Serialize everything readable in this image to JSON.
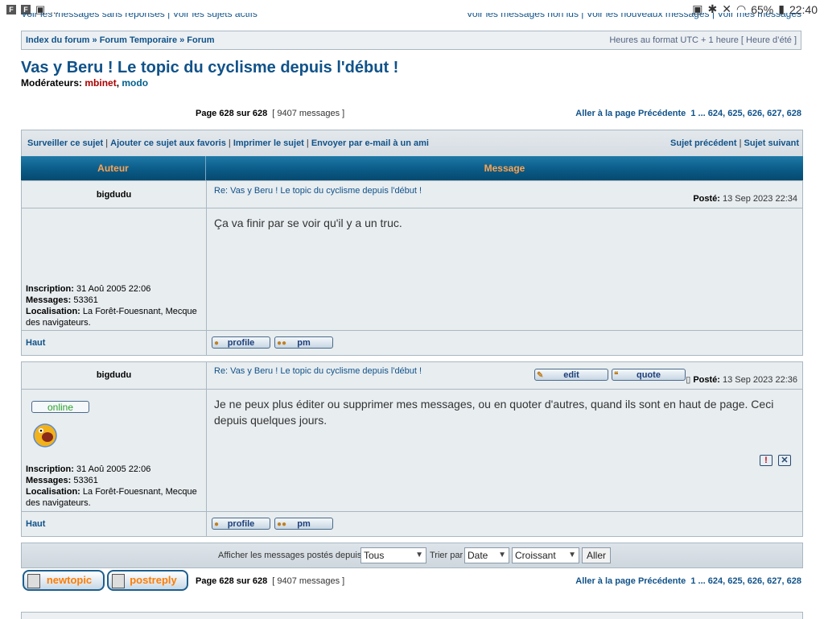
{
  "statusbar": {
    "icons": [
      "F",
      "F",
      "▣"
    ],
    "dots": "...",
    "battery": "65%",
    "time": "22:40"
  },
  "cut_links": {
    "left": "Voir les messages sans réponses | Voir les sujets actifs",
    "right": "Voir les messages non lus | Voir les nouveaux messages | Voir mes messages"
  },
  "breadcrumb": {
    "index": "Index du forum",
    "sep": " » ",
    "f1": "Forum Temporaire",
    "f2": "Forum",
    "timezone": "Heures au format UTC + 1 heure [ Heure d’été ]"
  },
  "topic": {
    "title": "Vas y Beru ! Le topic du cyclisme depuis l'début !",
    "mods_label": "Modérateurs:",
    "mod1": "mbinet",
    "mod2": "modo"
  },
  "pagination": {
    "page": "Page 628 sur 628",
    "count": "[ 9407 messages ]",
    "goto_label": "Aller à la page",
    "prev": "Précédente",
    "pages": "1 ... 624, 625, 626, 627, 628"
  },
  "tools": {
    "watch": "Surveiller ce sujet",
    "fav": "Ajouter ce sujet aux favoris",
    "print": "Imprimer le sujet",
    "email": "Envoyer par e-mail à un ami",
    "prev_topic": "Sujet précédent",
    "next_topic": "Sujet suivant"
  },
  "table_head": {
    "author": "Auteur",
    "message": "Message"
  },
  "posts": [
    {
      "author": "bigdudu",
      "subject": "Re: Vas y Beru ! Le topic du cyclisme depuis l'début !",
      "posted_label": "Posté:",
      "posted": "13 Sep 2023 22:34",
      "body": "Ça va finir par se voir qu'il y a un truc.",
      "inscription_label": "Inscription:",
      "inscription": "31 Aoû 2005 22:06",
      "messages_label": "Messages:",
      "messages": "53361",
      "location_label": "Localisation:",
      "location": "La Forêt-Fouesnant, Mecque des navigateurs.",
      "top": "Haut",
      "profile_btn": "profile",
      "pm_btn": "pm"
    },
    {
      "author": "bigdudu",
      "subject": "Re: Vas y Beru ! Le topic du cyclisme depuis l'début !",
      "posted_label": "Posté:",
      "posted": "13 Sep 2023 22:36",
      "body": "Je ne peux plus éditer ou supprimer mes messages, ou en quoter d'autres, quand ils sont en haut de page. Ceci depuis quelques jours.",
      "online": "online",
      "edit_btn": "edit",
      "quote_btn": "quote",
      "inscription_label": "Inscription:",
      "inscription": "31 Aoû 2005 22:06",
      "messages_label": "Messages:",
      "messages": "53361",
      "location_label": "Localisation:",
      "location": "La Forêt-Fouesnant, Mecque des navigateurs.",
      "top": "Haut",
      "profile_btn": "profile",
      "pm_btn": "pm"
    }
  ],
  "filter": {
    "label": "Afficher les messages postés depuis:",
    "since": "Tous",
    "sort_label": "Trier par",
    "sort": "Date",
    "order": "Croissant",
    "go": "Aller"
  },
  "buttons": {
    "newtopic": "newtopic",
    "postreply": "postreply"
  },
  "colors": {
    "link": "#105289",
    "header_bg": "#0a5985",
    "header_text": "#ffa34f",
    "orange_btn": "#ff7c00"
  }
}
